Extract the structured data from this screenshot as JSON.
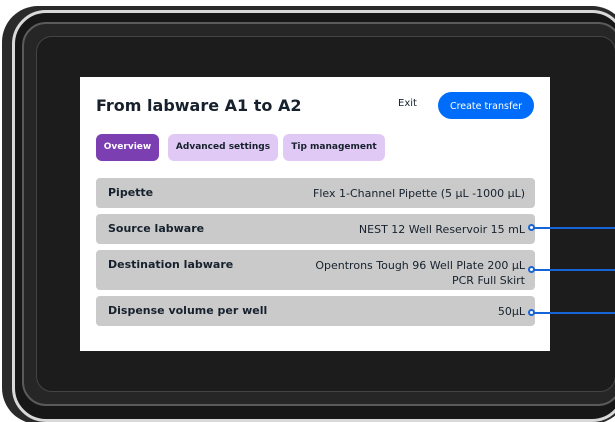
{
  "header": {
    "title": "From labware A1 to A2",
    "exit_label": "Exit",
    "create_label": "Create transfer"
  },
  "tabs": [
    {
      "label": "Overview",
      "active": true
    },
    {
      "label": "Advanced settings",
      "active": false
    },
    {
      "label": "Tip management",
      "active": false
    }
  ],
  "rows": [
    {
      "label": "Pipette",
      "value_line1": "Flex 1-Channel Pipette (5 µL -1000 µL)",
      "value_line2": ""
    },
    {
      "label": "Source labware",
      "value_line1": "NEST 12 Well Reservoir 15 mL",
      "value_line2": ""
    },
    {
      "label": "Destination labware",
      "value_line1": "Opentrons Tough 96 Well Plate 200 µL",
      "value_line2": "PCR Full Skirt"
    },
    {
      "label": "Dispense volume per well",
      "value_line1": "50µL",
      "value_line2": ""
    }
  ],
  "colors": {
    "accent_blue": "#006cfa",
    "tab_active": "#7b3fb2",
    "tab_inactive": "#e1c9f5",
    "row_bg": "#cacaca",
    "callout": "#1565d8"
  }
}
